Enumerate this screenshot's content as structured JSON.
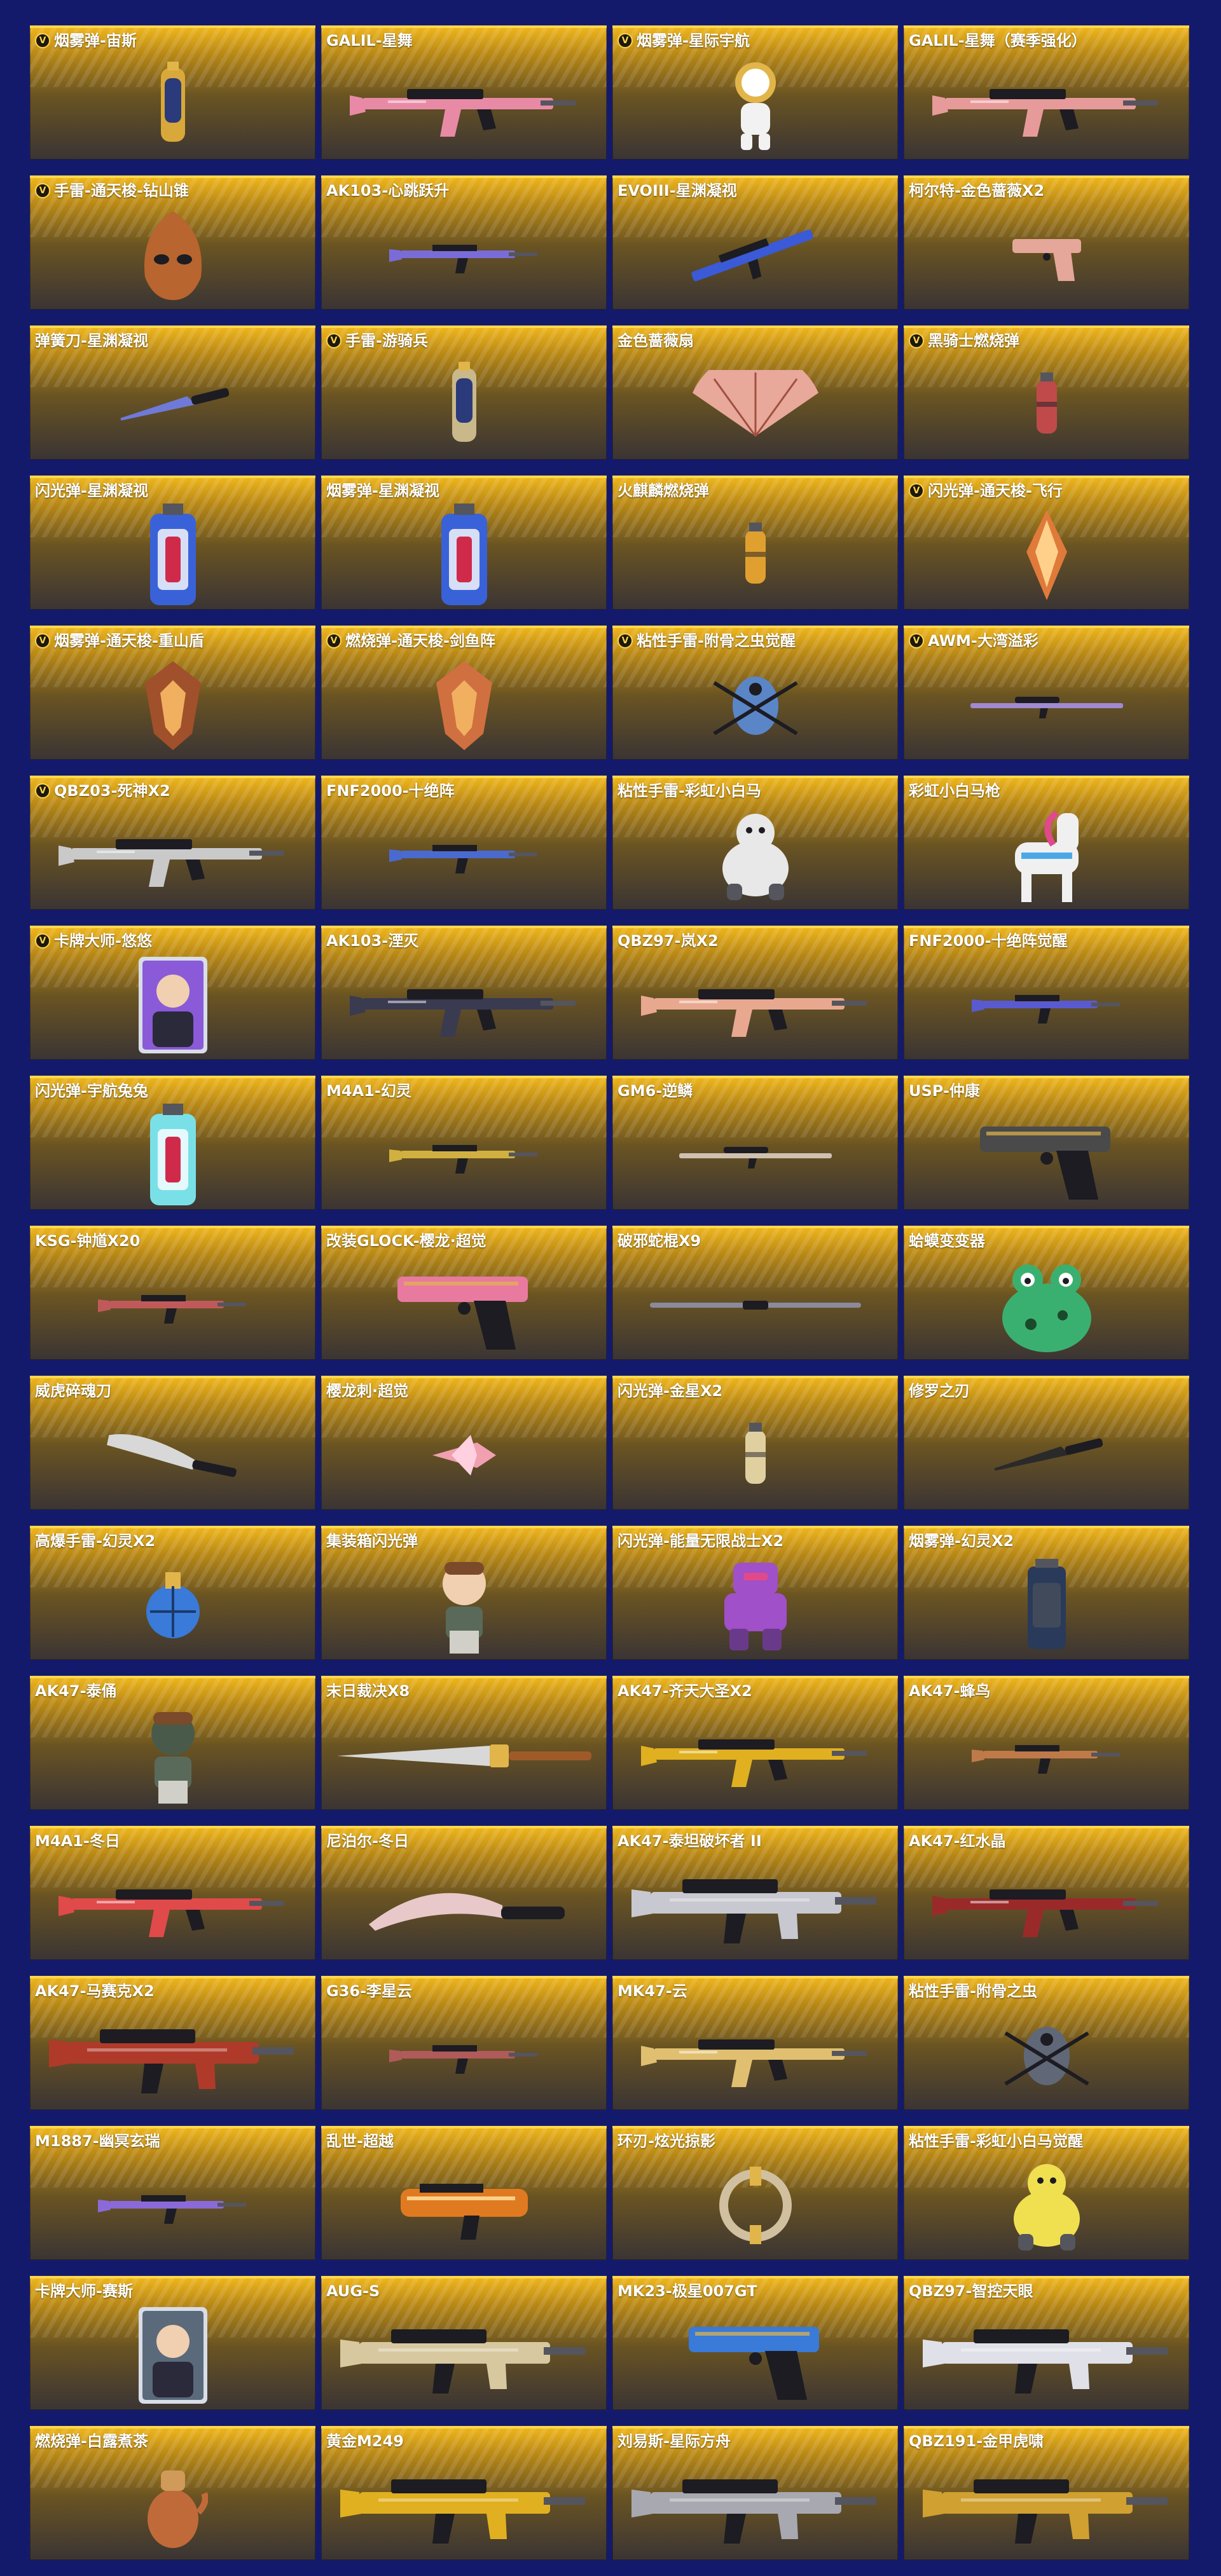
{
  "items": [
    {
      "name": "烟雾弹-宙斯",
      "v": true,
      "type": "grenade",
      "color": "#d8a83a"
    },
    {
      "name": "GALIL-星舞",
      "v": false,
      "type": "rifle",
      "color": "#e88aa6"
    },
    {
      "name": "烟雾弹-星际宇航",
      "v": true,
      "type": "figure",
      "color": "#f2f2f2"
    },
    {
      "name": "GALIL-星舞（赛季强化）",
      "v": false,
      "type": "rifle",
      "color": "#e79a9a"
    },
    {
      "name": "手雷-通天梭-钻山锥",
      "v": true,
      "type": "mask",
      "color": "#b8652f"
    },
    {
      "name": "AK103-心跳跃升",
      "v": false,
      "type": "rifle-small",
      "color": "#7a6cd8"
    },
    {
      "name": "EVOIII-星渊凝视",
      "v": false,
      "type": "smg",
      "color": "#3a5ad8"
    },
    {
      "name": "柯尔特-金色蔷薇X2",
      "v": false,
      "type": "pistol",
      "color": "#e5a79a"
    },
    {
      "name": "弹簧刀-星渊凝视",
      "v": false,
      "type": "knife",
      "color": "#6f7ad8"
    },
    {
      "name": "手雷-游骑兵",
      "v": true,
      "type": "grenade",
      "color": "#c8b88a"
    },
    {
      "name": "金色蔷薇扇",
      "v": false,
      "type": "fan",
      "color": "#e8a89a"
    },
    {
      "name": "黑骑士燃烧弹",
      "v": true,
      "type": "grenade-small",
      "color": "#c04a4a"
    },
    {
      "name": "闪光弹-星渊凝视",
      "v": false,
      "type": "flash",
      "color": "#3a62d8"
    },
    {
      "name": "烟雾弹-星渊凝视",
      "v": false,
      "type": "flash",
      "color": "#3a62d8"
    },
    {
      "name": "火麒麟燃烧弹",
      "v": false,
      "type": "grenade-small",
      "color": "#e0a030"
    },
    {
      "name": "闪光弹-通天梭-飞行",
      "v": true,
      "type": "crystal",
      "color": "#e07a3a"
    },
    {
      "name": "烟雾弹-通天梭-重山盾",
      "v": true,
      "type": "shield",
      "color": "#a0502a"
    },
    {
      "name": "燃烧弹-通天梭-剑鱼阵",
      "v": true,
      "type": "shield",
      "color": "#d07040"
    },
    {
      "name": "粘性手雷-附骨之虫觉醒",
      "v": true,
      "type": "bug",
      "color": "#5a86c8"
    },
    {
      "name": "AWM-大湾溢彩",
      "v": true,
      "type": "sniper",
      "color": "#a08ad0"
    },
    {
      "name": "QBZ03-死神X2",
      "v": true,
      "type": "rifle",
      "color": "#c9c9c9"
    },
    {
      "name": "FNF2000-十绝阵",
      "v": false,
      "type": "rifle-small",
      "color": "#4a6ad0"
    },
    {
      "name": "粘性手雷-彩虹小白马",
      "v": false,
      "type": "animal",
      "color": "#e8e8e8"
    },
    {
      "name": "彩虹小白马枪",
      "v": false,
      "type": "horse",
      "color": "#f0f0f0"
    },
    {
      "name": "卡牌大师-悠悠",
      "v": true,
      "type": "card",
      "color": "#8a5ad8"
    },
    {
      "name": "AK103-湮灭",
      "v": false,
      "type": "rifle",
      "color": "#3a3a50"
    },
    {
      "name": "QBZ97-岚X2",
      "v": false,
      "type": "rifle",
      "color": "#e8a890"
    },
    {
      "name": "FNF2000-十绝阵觉醒",
      "v": false,
      "type": "rifle-small",
      "color": "#5a5ad0"
    },
    {
      "name": "闪光弹-宇航兔兔",
      "v": false,
      "type": "flash",
      "color": "#7ae0e8"
    },
    {
      "name": "M4A1-幻灵",
      "v": false,
      "type": "rifle-small",
      "color": "#d0b040"
    },
    {
      "name": "GM6-逆鳞",
      "v": false,
      "type": "sniper",
      "color": "#d0c0b0"
    },
    {
      "name": "USP-仲康",
      "v": false,
      "type": "pistol-big",
      "color": "#4a4a4a"
    },
    {
      "name": "KSG-钟馗X20",
      "v": false,
      "type": "rifle-small",
      "color": "#c05a5a"
    },
    {
      "name": "改装GLOCK-樱龙·超觉",
      "v": false,
      "type": "pistol-big",
      "color": "#e87aa0"
    },
    {
      "name": "破邪蛇棍X9",
      "v": false,
      "type": "staff",
      "color": "#8a8a9a"
    },
    {
      "name": "蛤蟆变变器",
      "v": false,
      "type": "frog",
      "color": "#3ab070"
    },
    {
      "name": "威虎碎魂刀",
      "v": false,
      "type": "blade",
      "color": "#d8d8d8"
    },
    {
      "name": "樱龙刺·超觉",
      "v": false,
      "type": "claw",
      "color": "#f0a0b0"
    },
    {
      "name": "闪光弹-金星X2",
      "v": false,
      "type": "grenade-small",
      "color": "#e0d0a0"
    },
    {
      "name": "修罗之刃",
      "v": false,
      "type": "knife",
      "color": "#2a2a2a"
    },
    {
      "name": "高爆手雷-幻灵X2",
      "v": false,
      "type": "ball",
      "color": "#3a7ad8"
    },
    {
      "name": "集装箱闪光弹",
      "v": false,
      "type": "doll",
      "color": "#f0d0b0"
    },
    {
      "name": "闪光弹-能量无限战士X2",
      "v": false,
      "type": "robot",
      "color": "#a050c8"
    },
    {
      "name": "烟雾弹-幻灵X2",
      "v": false,
      "type": "canister",
      "color": "#2a3a5a"
    },
    {
      "name": "AK47-泰俑",
      "v": false,
      "type": "doll",
      "color": "#4a5a4a"
    },
    {
      "name": "末日裁决X8",
      "v": false,
      "type": "sword",
      "color": "#d8d8d8"
    },
    {
      "name": "AK47-齐天大圣X2",
      "v": false,
      "type": "rifle",
      "color": "#e0b020"
    },
    {
      "name": "AK47-蜂鸟",
      "v": false,
      "type": "rifle-small",
      "color": "#c07a4a"
    },
    {
      "name": "M4A1-冬日",
      "v": false,
      "type": "rifle",
      "color": "#e04a4a"
    },
    {
      "name": "尼泊尔-冬日",
      "v": false,
      "type": "kukri",
      "color": "#e8c8c8"
    },
    {
      "name": "AK47-泰坦破坏者 II",
      "v": false,
      "type": "rifle-heavy",
      "color": "#c8c8d0"
    },
    {
      "name": "AK47-红水晶",
      "v": false,
      "type": "rifle",
      "color": "#9a2a2a"
    },
    {
      "name": "AK47-马赛克X2",
      "v": false,
      "type": "rifle-heavy",
      "color": "#b03a2a"
    },
    {
      "name": "G36-李星云",
      "v": false,
      "type": "rifle-small",
      "color": "#b05a5a"
    },
    {
      "name": "MK47-云",
      "v": false,
      "type": "rifle",
      "color": "#e0c070"
    },
    {
      "name": "粘性手雷-附骨之虫",
      "v": false,
      "type": "bug",
      "color": "#606878"
    },
    {
      "name": "M1887-幽冥玄瑞",
      "v": false,
      "type": "rifle-small",
      "color": "#8a6ad8"
    },
    {
      "name": "乱世-超越",
      "v": false,
      "type": "launcher",
      "color": "#e07a20"
    },
    {
      "name": "环刃-炫光掠影",
      "v": false,
      "type": "ring",
      "color": "#d0c0a0"
    },
    {
      "name": "粘性手雷-彩虹小白马觉醒",
      "v": false,
      "type": "animal",
      "color": "#f0e050"
    },
    {
      "name": "卡牌大师-赛斯",
      "v": false,
      "type": "card",
      "color": "#5a6a7a"
    },
    {
      "name": "AUG-S",
      "v": false,
      "type": "rifle-heavy",
      "color": "#d8c8a0"
    },
    {
      "name": "MK23-极星007GT",
      "v": false,
      "type": "pistol-big",
      "color": "#3a7ad8"
    },
    {
      "name": "QBZ97-智控天眼",
      "v": false,
      "type": "rifle-heavy",
      "color": "#e0e0e8"
    },
    {
      "name": "燃烧弹-白露煮茶",
      "v": false,
      "type": "teapot",
      "color": "#c06a3a"
    },
    {
      "name": "黄金M249",
      "v": false,
      "type": "rifle-heavy",
      "color": "#e0b020"
    },
    {
      "name": "刘易斯-星际方舟",
      "v": false,
      "type": "rifle-heavy",
      "color": "#a8a8b0"
    },
    {
      "name": "QBZ191-金甲虎啸",
      "v": false,
      "type": "rifle-heavy",
      "color": "#d0a030"
    }
  ]
}
